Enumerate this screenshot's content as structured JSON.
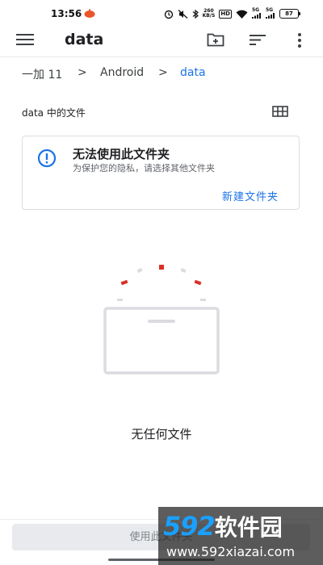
{
  "status_bar": {
    "time": "13:56",
    "speed_value": "260",
    "speed_unit": "KB/S",
    "hd_label": "HD",
    "net_label_1": "5G",
    "net_label_2": "5G",
    "battery": "87"
  },
  "app_bar": {
    "title": "data",
    "icons": [
      "menu-icon",
      "new-folder-icon",
      "sort-icon",
      "more-vert-icon"
    ]
  },
  "breadcrumb": {
    "items": [
      "一加 11",
      "Android",
      "data"
    ],
    "separator": ">"
  },
  "section": {
    "title": "data 中的文件",
    "view_icon": "grid-view-icon"
  },
  "info_card": {
    "icon": "info-icon",
    "title": "无法使用此文件夹",
    "description": "为保护您的隐私，请选择其他文件夹",
    "action_label": "新建文件夹"
  },
  "empty_state": {
    "text": "无任何文件",
    "icon": "empty-tray-icon"
  },
  "bottom": {
    "button_label": "使用此文件夹"
  },
  "watermark": {
    "logo_digits": "592",
    "logo_text": "软件园",
    "url": "www.592xiazai.com"
  },
  "colors": {
    "accent": "#1a73e8",
    "empty_state_red": "#d93025",
    "text_primary": "#202124",
    "text_secondary": "#5f6368"
  }
}
